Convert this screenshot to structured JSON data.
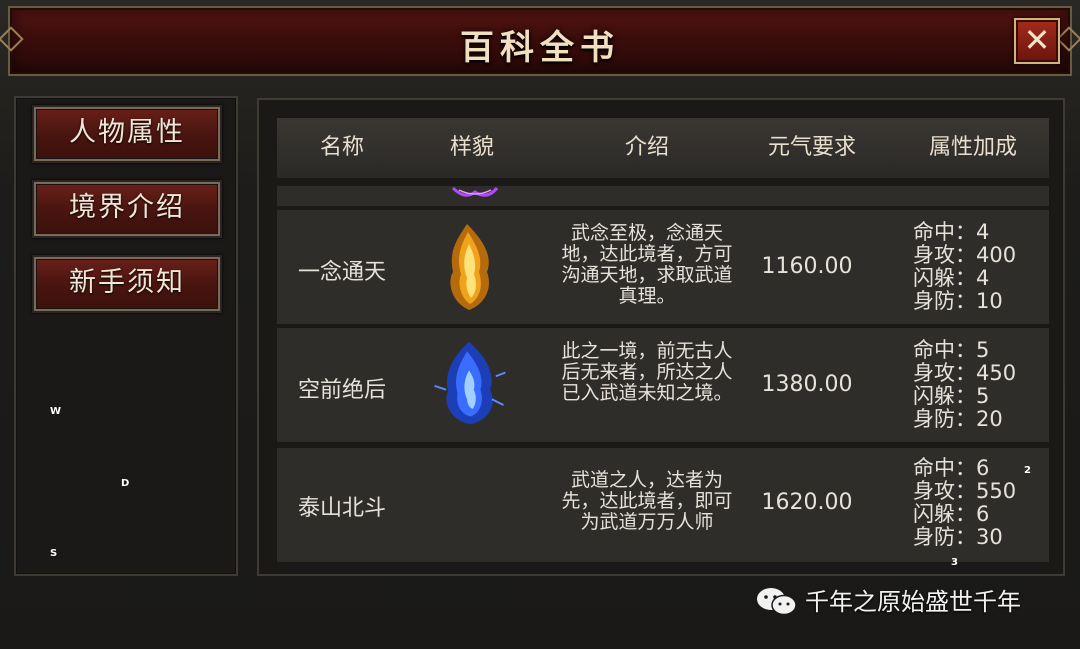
{
  "window": {
    "title": "百科全书",
    "close_label": "✕"
  },
  "sidebar": {
    "items": [
      {
        "label": "人物属性"
      },
      {
        "label": "境界介绍"
      },
      {
        "label": "新手须知"
      }
    ],
    "markers": [
      "W",
      "D",
      "S"
    ]
  },
  "table": {
    "columns": [
      "名称",
      "样貌",
      "介绍",
      "元气要求",
      "属性加成"
    ],
    "rows": [
      {
        "name": "一念通天",
        "appearance_icon": "gold-flame-icon",
        "intro": "武念至极，念通天地，达此境者，方可沟通天地，求取武道真理。",
        "requirement": "1160.00",
        "attributes": [
          "命中：4",
          "身攻：400",
          "闪躲：4",
          "身防：10"
        ]
      },
      {
        "name": "空前绝后",
        "appearance_icon": "blue-flame-icon",
        "intro": "此之一境，前无古人后无来者，所达之人已入武道未知之境。",
        "requirement": "1380.00",
        "attributes": [
          "命中：5",
          "身攻：450",
          "闪躲：5",
          "身防：20"
        ]
      },
      {
        "name": "泰山北斗",
        "appearance_icon": "",
        "intro": "武道之人，达者为先，达此境者，即可为武道万万人师",
        "requirement": "1620.00",
        "attributes": [
          "命中：6",
          "身攻：550",
          "闪躲：6",
          "身防：30"
        ]
      }
    ],
    "row_markers": [
      "2",
      "3"
    ]
  },
  "watermark": {
    "text": "千年之原始盛世千年",
    "icon": "wechat-icon"
  },
  "colors": {
    "title_bar": "#3a0d0b",
    "button_red": "#4a1510",
    "gold_flame": "#f0a21c",
    "blue_flame": "#3a6cff",
    "purple_flame": "#a640ff"
  }
}
